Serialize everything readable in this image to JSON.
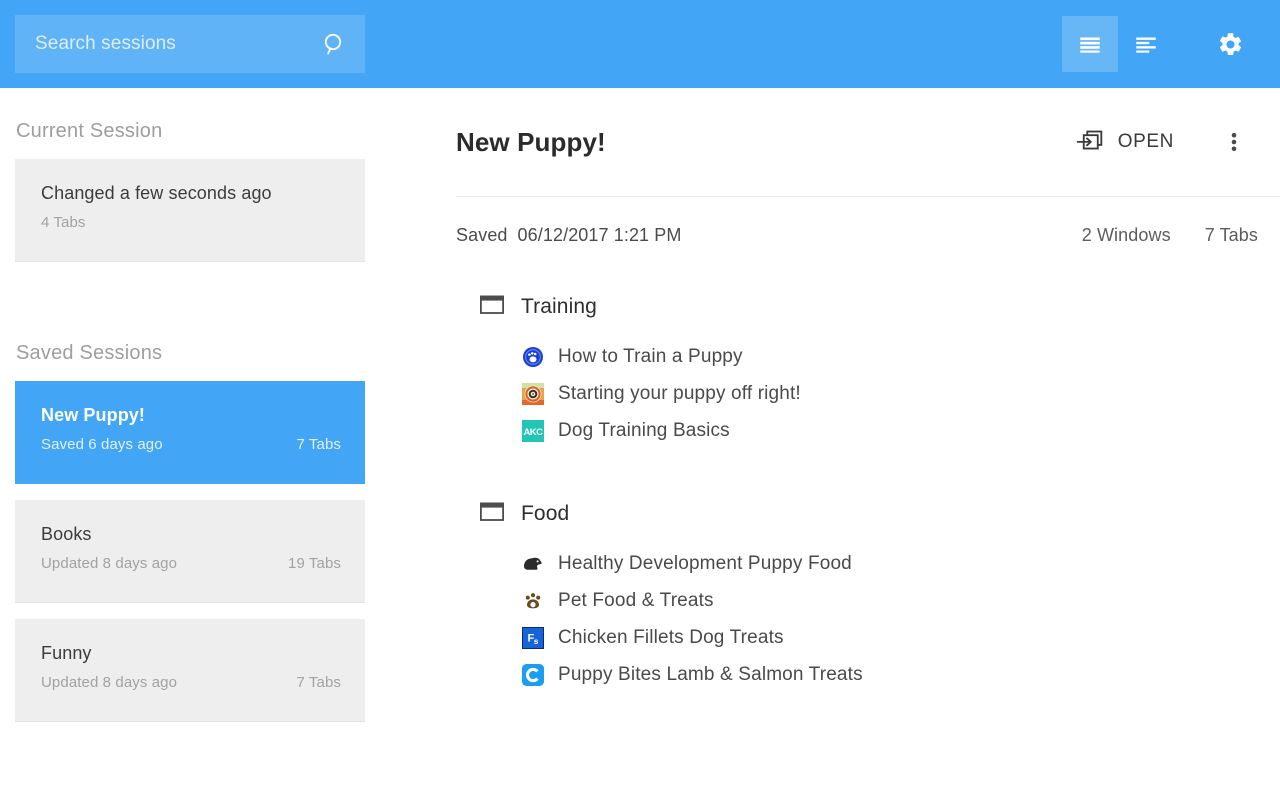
{
  "theme": {
    "accent": "#42a5f5",
    "card_bg": "#eeeeee",
    "text": "#3c3c3c",
    "muted": "#a2a2a2"
  },
  "appbar": {
    "search": {
      "placeholder": "Search sessions",
      "value": "",
      "icon": "search-icon"
    },
    "actions": [
      {
        "name": "view-list-dense-icon",
        "label": "",
        "selected": true
      },
      {
        "name": "view-list-compact-icon",
        "label": "",
        "selected": false
      },
      {
        "name": "gear-icon",
        "label": "",
        "selected": false
      }
    ]
  },
  "sidebar": {
    "current_session_title": "Current Session",
    "current_session": {
      "title": "Changed a few seconds ago",
      "tabs": "4 Tabs",
      "count": ""
    },
    "saved_sessions_title": "Saved Sessions",
    "saved_sessions": [
      {
        "title": "New Puppy!",
        "subtitle": "Saved 6 days ago",
        "tabs": "7 Tabs",
        "selected": true
      },
      {
        "title": "Books",
        "subtitle": "Updated 8 days ago",
        "tabs": "19 Tabs",
        "selected": false
      },
      {
        "title": "Funny",
        "subtitle": "Updated 8 days ago",
        "tabs": "7 Tabs",
        "selected": false
      }
    ]
  },
  "main": {
    "title": "New Puppy!",
    "open_label": "OPEN",
    "open_icon": "open-in-window-icon",
    "kebab_icon": "more-vertical-icon",
    "saved_label": "Saved",
    "saved_date": "06/12/2017 1:21 PM",
    "windows_count": "2 Windows",
    "tabs_count": "7 Tabs",
    "windows": [
      {
        "name": "Training",
        "icon": "browser-window-icon",
        "tabs": [
          {
            "title": "How to Train a Puppy",
            "favicon": "blue-paw-circle-favicon"
          },
          {
            "title": "Starting your puppy off right!",
            "favicon": "orange-spiral-favicon"
          },
          {
            "title": "Dog Training Basics",
            "favicon": "akc-teal-favicon"
          }
        ]
      },
      {
        "name": "Food",
        "icon": "browser-window-icon",
        "tabs": [
          {
            "title": "Healthy Development Puppy Food",
            "favicon": "dark-dog-head-favicon"
          },
          {
            "title": "Pet Food & Treats",
            "favicon": "brown-paw-favicon"
          },
          {
            "title": "Chicken Fillets Dog Treats",
            "favicon": "fs-blue-square-favicon"
          },
          {
            "title": "Puppy Bites Lamb & Salmon Treats",
            "favicon": "c-blue-rounded-favicon"
          }
        ]
      }
    ]
  }
}
